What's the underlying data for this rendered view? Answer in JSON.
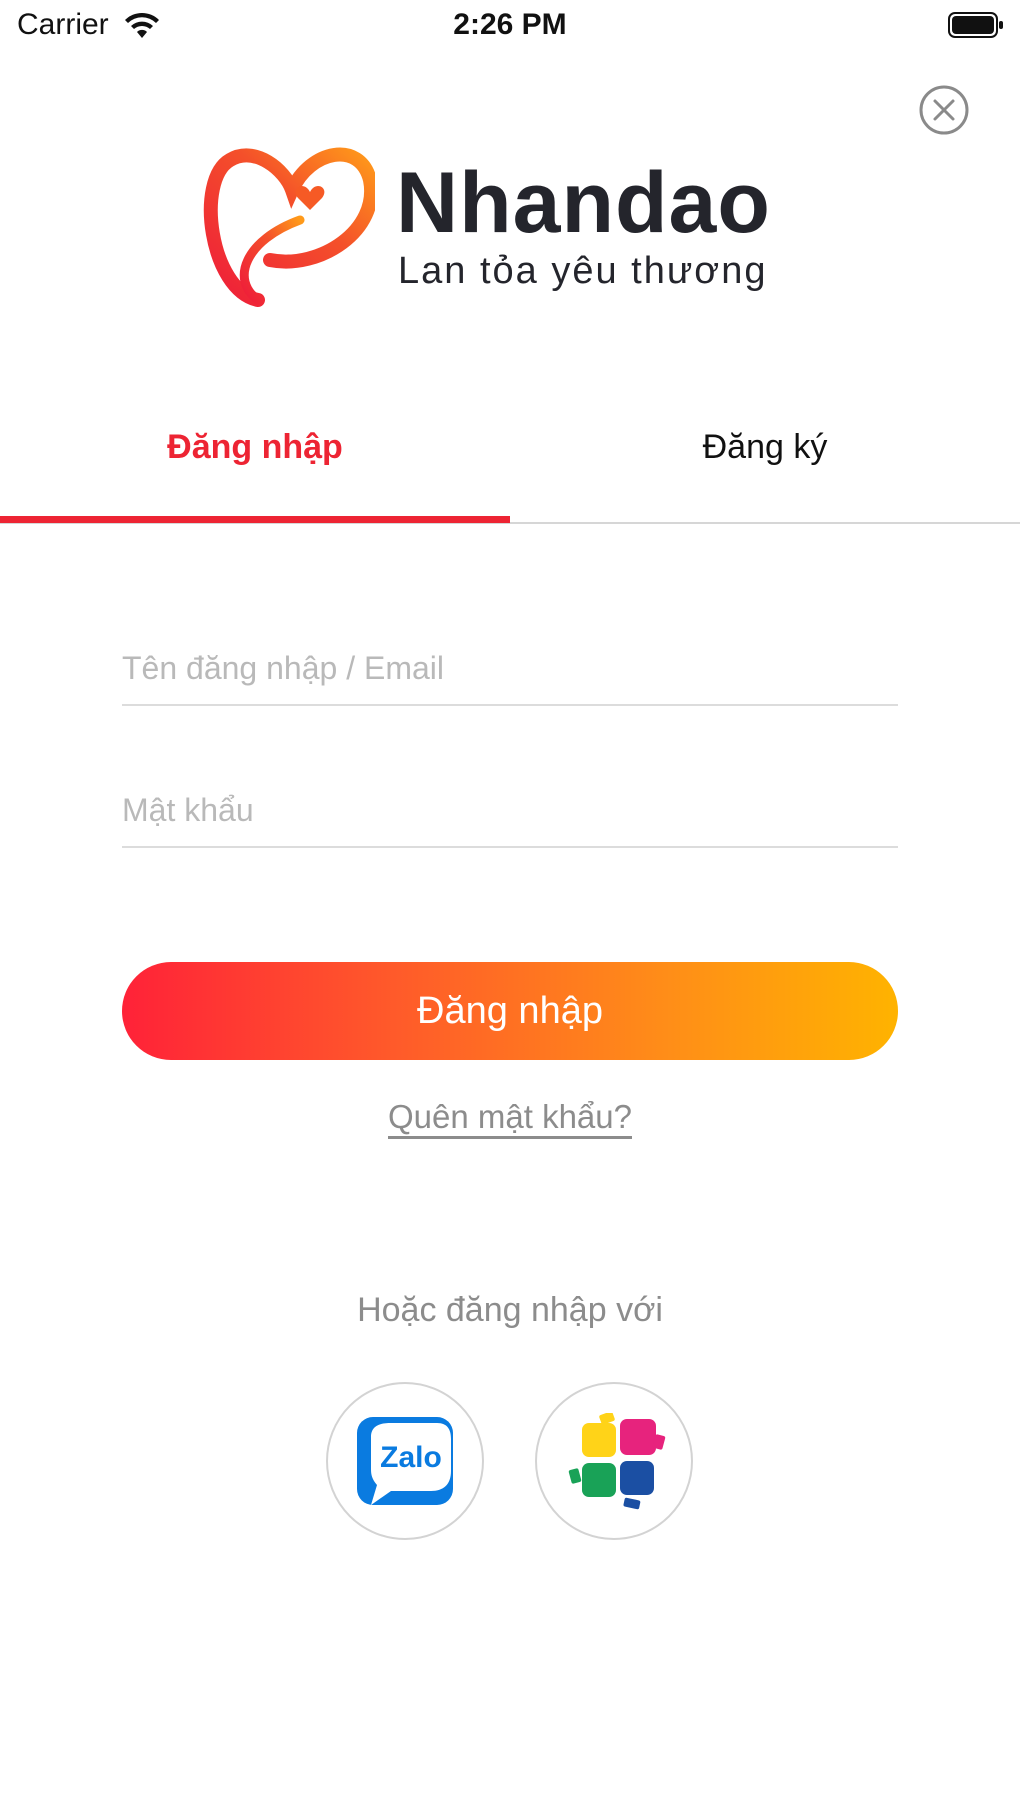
{
  "status_bar": {
    "carrier": "Carrier",
    "time": "2:26 PM",
    "icons": [
      "wifi-icon",
      "battery-icon"
    ]
  },
  "close_icon": "close-icon",
  "brand": {
    "name": "Nhandao",
    "tagline": "Lan tỏa yêu thương",
    "colors": {
      "primary": "#ed2433",
      "accent": "#ffb300",
      "text": "#24252c"
    }
  },
  "tabs": [
    {
      "label": "Đăng nhập",
      "active": true
    },
    {
      "label": "Đăng ký",
      "active": false
    }
  ],
  "form": {
    "username": {
      "placeholder": "Tên đăng nhập / Email",
      "value": ""
    },
    "password": {
      "placeholder": "Mật khẩu",
      "value": ""
    },
    "submit_label": "Đăng nhập",
    "forgot_label": "Quên mật khẩu?"
  },
  "social": {
    "prompt": "Hoặc đăng nhập với",
    "providers": [
      {
        "icon": "zalo-icon",
        "label": "Zalo"
      },
      {
        "icon": "colorful-tiles-icon",
        "label": ""
      }
    ]
  }
}
